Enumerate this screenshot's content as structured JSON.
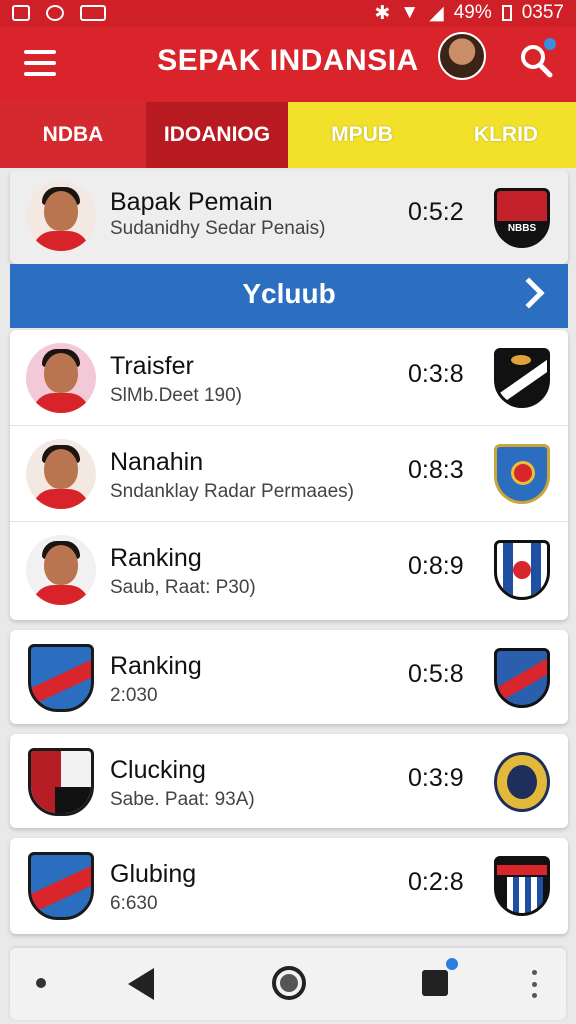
{
  "status_bar": {
    "battery": "49%",
    "time": "0357"
  },
  "app_bar": {
    "title": "SEPAK INDANSIA"
  },
  "tabs": [
    {
      "label": "NDBA"
    },
    {
      "label": "IDOANIOG"
    },
    {
      "label": "MPUB"
    },
    {
      "label": "KLRID"
    }
  ],
  "featured": {
    "name": "Bapak Pemain",
    "subtitle": "Sudanidhy  Sedar Penais)",
    "score": "0:5:2",
    "badge_text": "NBBS"
  },
  "banner": {
    "label": "Ycluub"
  },
  "players": [
    {
      "name": "Traisfer",
      "subtitle": "SlMb.Deet 190)",
      "score": "0:3:8"
    },
    {
      "name": "Nanahin",
      "subtitle": "Sndanklay  Radar Permaaes)",
      "score": "0:8:3"
    },
    {
      "name": "Ranking",
      "subtitle": "Saub, Raat: P30)",
      "score": "0:8:9"
    }
  ],
  "clubs": [
    {
      "name": "Ranking",
      "subtitle": "2:030",
      "score": "0:5:8"
    },
    {
      "name": "Clucking",
      "subtitle": "Sabe. Paat: 93A)",
      "score": "0:3:9"
    },
    {
      "name": "Glubing",
      "subtitle": "6:630",
      "score": "0:2:8"
    }
  ],
  "colors": {
    "primary_red": "#d9242b",
    "tab_yellow": "#f1e12a",
    "banner_blue": "#2c6fc1"
  }
}
